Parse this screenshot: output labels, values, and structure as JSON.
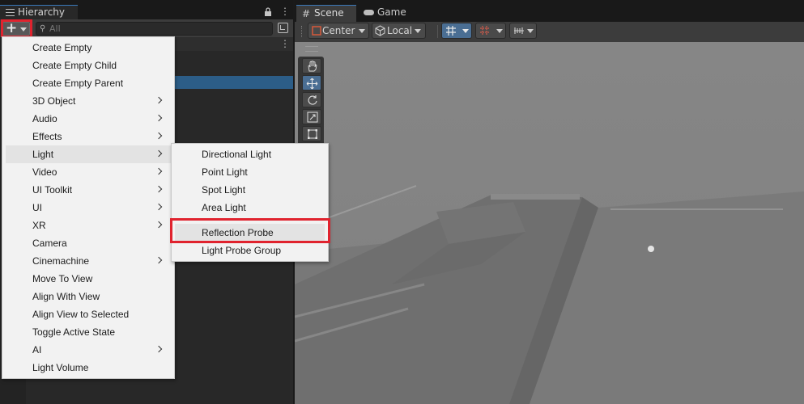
{
  "hierarchy": {
    "tab_label": "Hierarchy",
    "search_placeholder": "All"
  },
  "scene": {
    "tab_scene": "Scene",
    "tab_game": "Game",
    "pivot_label": "Center",
    "space_label": "Local"
  },
  "create_menu": {
    "items": [
      {
        "label": "Create Empty",
        "submenu": false
      },
      {
        "label": "Create Empty Child",
        "submenu": false
      },
      {
        "label": "Create Empty Parent",
        "submenu": false
      },
      {
        "label": "3D Object",
        "submenu": true
      },
      {
        "label": "Audio",
        "submenu": true
      },
      {
        "label": "Effects",
        "submenu": true
      },
      {
        "label": "Light",
        "submenu": true
      },
      {
        "label": "Video",
        "submenu": true
      },
      {
        "label": "UI Toolkit",
        "submenu": true
      },
      {
        "label": "UI",
        "submenu": true
      },
      {
        "label": "XR",
        "submenu": true
      },
      {
        "label": "Camera",
        "submenu": false
      },
      {
        "label": "Cinemachine",
        "submenu": true
      },
      {
        "label": "Move To View",
        "submenu": false
      },
      {
        "label": "Align With View",
        "submenu": false
      },
      {
        "label": "Align View to Selected",
        "submenu": false
      },
      {
        "label": "Toggle Active State",
        "submenu": false
      },
      {
        "label": "AI",
        "submenu": true
      },
      {
        "label": "Light Volume",
        "submenu": false
      }
    ]
  },
  "light_submenu": {
    "items": [
      {
        "label": "Directional Light"
      },
      {
        "label": "Point Light"
      },
      {
        "label": "Spot Light"
      },
      {
        "label": "Area Light"
      },
      {
        "label": "Reflection Probe"
      },
      {
        "label": "Light Probe Group"
      }
    ]
  }
}
